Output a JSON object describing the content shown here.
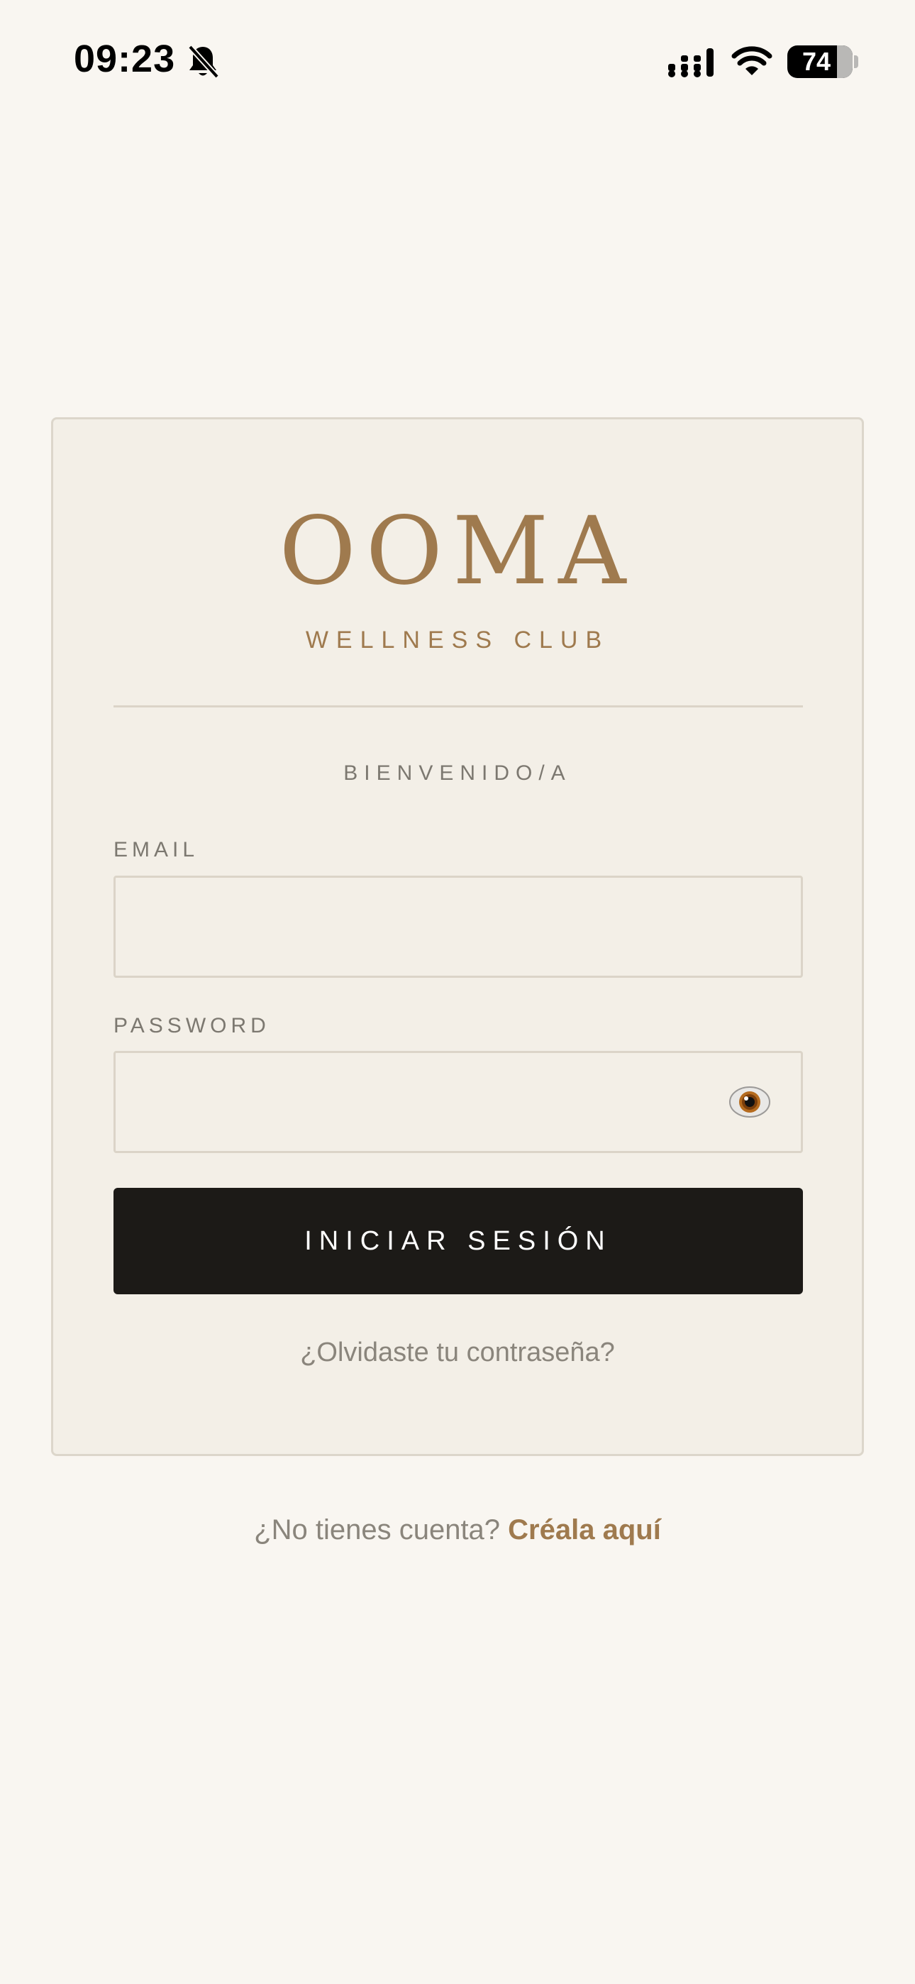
{
  "status_bar": {
    "time": "09:23",
    "battery_level": "74",
    "icons": [
      "bell-slash-icon",
      "signal-icon",
      "wifi-icon",
      "battery-icon"
    ]
  },
  "brand": {
    "logo": "OOMA",
    "subtitle": "WELLNESS CLUB",
    "accent_color": "#9f7a4e"
  },
  "login_form": {
    "welcome": "BIENVENIDO/A",
    "email_label": "EMAIL",
    "email_value": "",
    "password_label": "PASSWORD",
    "password_value": "",
    "password_toggle_icon": "eye-icon",
    "submit_label": "INICIAR SESIÓN",
    "forgot_link": "¿Olvidaste tu contraseña?"
  },
  "signup": {
    "prompt": "¿No tienes cuenta?",
    "link": "Créala aquí"
  },
  "colors": {
    "background": "#f9f6f1",
    "card": "#f3efe7",
    "button": "#1c1a17",
    "muted_text": "#8a857c"
  }
}
